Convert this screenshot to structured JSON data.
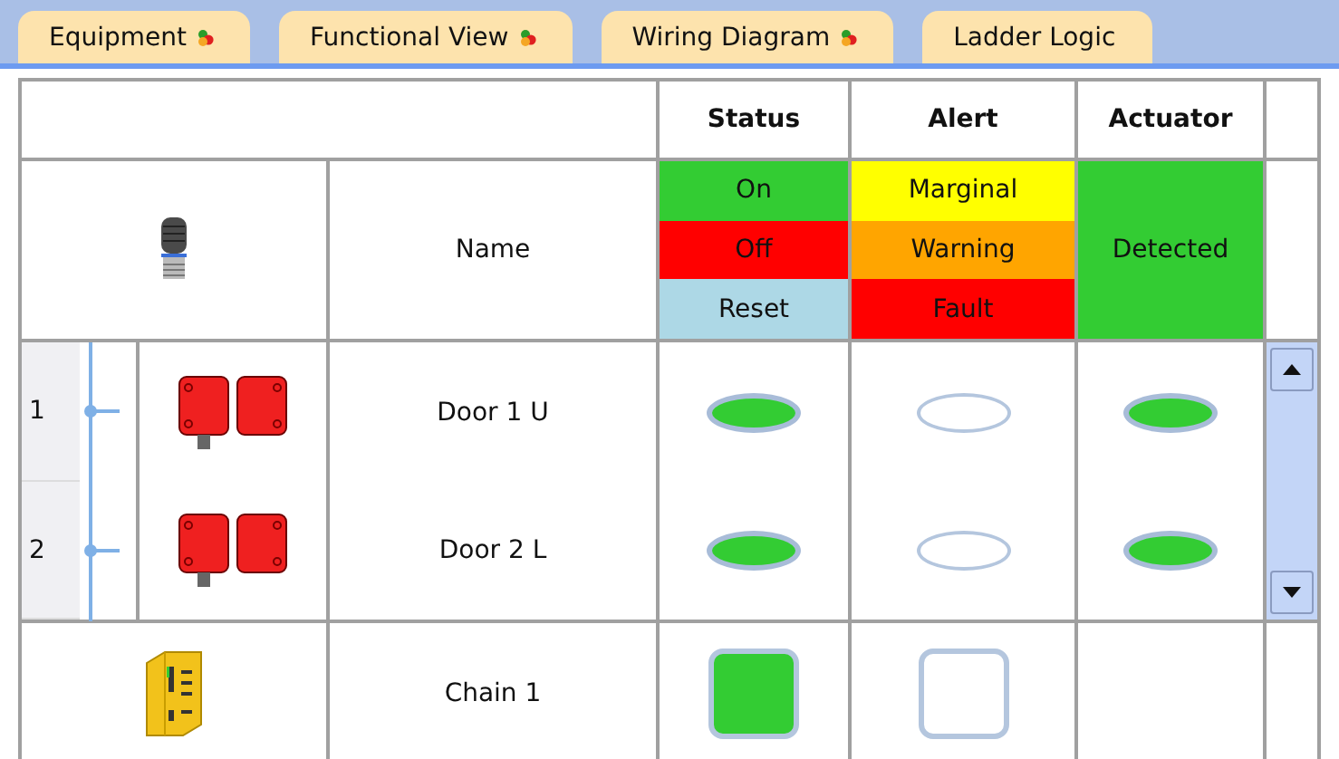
{
  "tabs": [
    {
      "label": "Equipment",
      "selected": false,
      "icon": true
    },
    {
      "label": "Functional View",
      "selected": false,
      "icon": true
    },
    {
      "label": "Wiring Diagram",
      "selected": false,
      "icon": true
    },
    {
      "label": "Ladder Logic",
      "selected": false,
      "icon": false
    }
  ],
  "table": {
    "columns": [
      "Status",
      "Alert",
      "Actuator"
    ],
    "legend": {
      "name_label": "Name",
      "status": [
        {
          "label": "On",
          "color": "#33cc33"
        },
        {
          "label": "Off",
          "color": "#ff0000"
        },
        {
          "label": "Reset",
          "color": "#add8e6"
        }
      ],
      "alert": [
        {
          "label": "Marginal",
          "color": "#ffff00"
        },
        {
          "label": "Warning",
          "color": "#ffa500"
        },
        {
          "label": "Fault",
          "color": "#ff0000"
        }
      ],
      "actuator": [
        {
          "label": "Detected",
          "color": "#33cc33"
        }
      ]
    },
    "devices": [
      {
        "number": "1",
        "name": "Door 1 U",
        "status": true,
        "alert": false,
        "actuator": true
      },
      {
        "number": "2",
        "name": "Door 2 L",
        "status": true,
        "alert": false,
        "actuator": true
      }
    ],
    "chain": {
      "name": "Chain 1",
      "status": true,
      "alert": false
    }
  }
}
